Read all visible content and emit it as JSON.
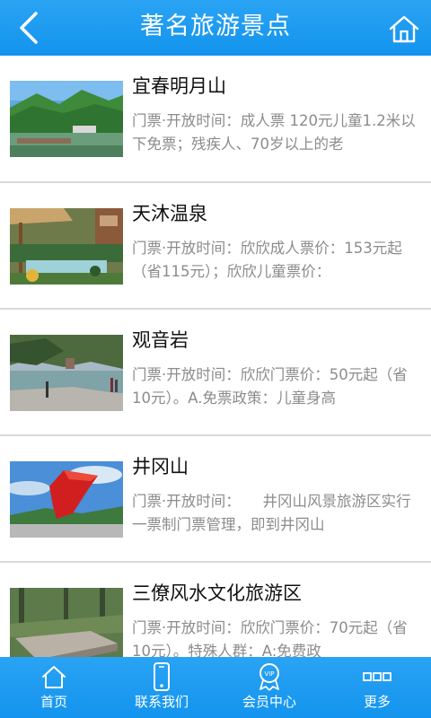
{
  "header": {
    "title": "著名旅游景点",
    "back_icon": "back-arrow-icon",
    "home_icon": "home-icon"
  },
  "attractions": [
    {
      "name": "宜春明月山",
      "desc": "门票·开放时间：成人票 120元儿童1.2米以下免票；残疾人、70岁以上的老"
    },
    {
      "name": "天沐温泉",
      "desc": "门票·开放时间：欣欣成人票价：153元起（省115元）；欣欣儿童票价："
    },
    {
      "name": "观音岩",
      "desc": "门票·开放时间：欣欣门票价：50元起（省10元）。A.免票政策：儿童身高"
    },
    {
      "name": "井冈山",
      "desc": "门票·开放时间：　　井冈山风景旅游区实行一票制门票管理，即到井冈山"
    },
    {
      "name": "三僚风水文化旅游区",
      "desc": "门票·开放时间：欣欣门票价：70元起（省10元）。特殊人群：A:免费政"
    }
  ],
  "tabbar": {
    "tabs": [
      {
        "label": "首页",
        "icon": "home-icon"
      },
      {
        "label": "联系我们",
        "icon": "phone-icon"
      },
      {
        "label": "会员中心",
        "icon": "vip-badge-icon"
      },
      {
        "label": "更多",
        "icon": "more-icon"
      }
    ]
  },
  "colors": {
    "accent": "#1a9af0",
    "title_text": "#111111",
    "desc_text": "#8c8c8c",
    "divider": "#d9d9d9"
  }
}
